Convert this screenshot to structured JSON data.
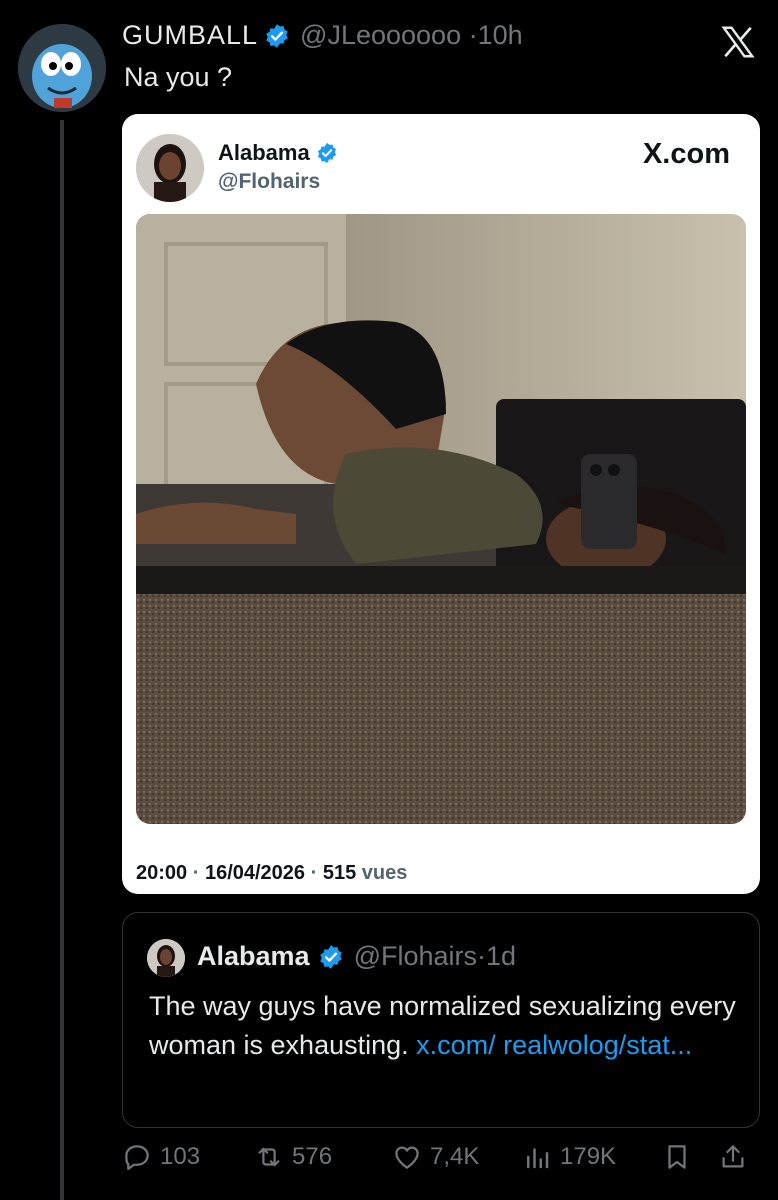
{
  "tweet": {
    "display_name": "GUMBALL",
    "handle": "@JLeoooooo",
    "age": "10h",
    "text": "Na you ?",
    "avatar_icon": "gumball-avatar-icon"
  },
  "card": {
    "author_name": "Alabama",
    "author_handle": "@Flohairs",
    "brand": "X.com",
    "time": "20:00",
    "date": "16/04/2026",
    "views_count": "515",
    "views_label": "vues"
  },
  "quote": {
    "author_name": "Alabama",
    "author_handle": "@Flohairs",
    "age": "1d",
    "text": "The way guys have normalized sexualizing every woman is exhausting. ",
    "link": "x.com/ realwolog/stat..."
  },
  "actions": {
    "replies": "103",
    "reposts": "576",
    "likes": "7,4K",
    "views": "179K"
  },
  "colors": {
    "background": "#000000",
    "verified": "#1d9bf0",
    "link": "#1d9bf0",
    "muted": "#71767b"
  }
}
